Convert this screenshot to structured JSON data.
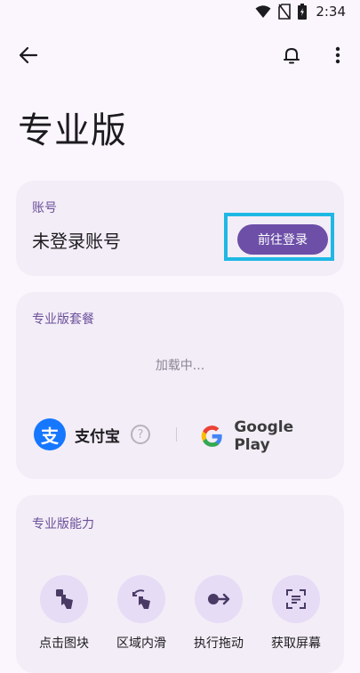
{
  "status_bar": {
    "time": "2:34"
  },
  "page": {
    "title": "专业版"
  },
  "account": {
    "label": "账号",
    "value": "未登录账号",
    "login_button": "前往登录"
  },
  "plan": {
    "label": "专业版套餐",
    "loading_text": "加载中...",
    "alipay_label": "支付宝",
    "alipay_logo_char": "支",
    "help_char": "?",
    "google_play_label": "Google Play"
  },
  "abilities": {
    "label": "专业版能力",
    "items": [
      {
        "label": "点击图块",
        "icon": "tap-icon"
      },
      {
        "label": "区域内滑",
        "icon": "swipe-area-icon"
      },
      {
        "label": "执行拖动",
        "icon": "drag-icon"
      },
      {
        "label": "获取屏幕",
        "icon": "capture-screen-icon"
      }
    ]
  },
  "colors": {
    "accent": "#6d4fa8",
    "highlight": "#1fb8e4",
    "card": "#f3edf7",
    "background": "#fbf6fd"
  }
}
